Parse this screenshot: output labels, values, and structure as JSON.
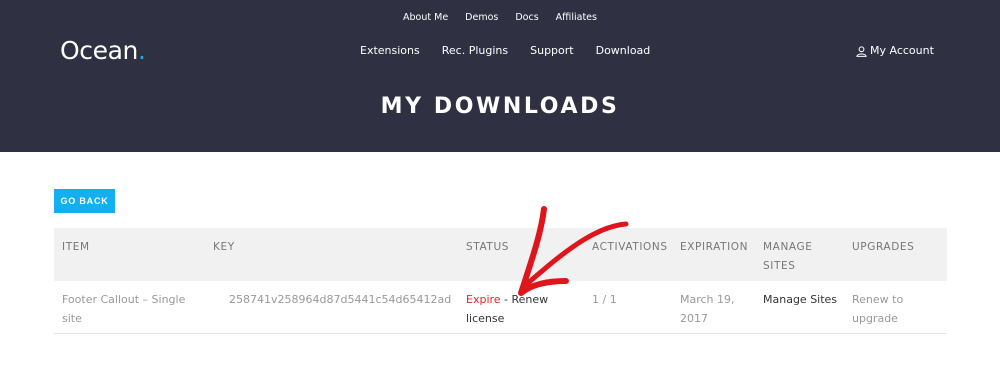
{
  "top_nav": [
    "About Me",
    "Demos",
    "Docs",
    "Affiliates"
  ],
  "logo": {
    "text": "Ocean",
    "dot": "."
  },
  "main_nav": [
    "Extensions",
    "Rec. Plugins",
    "Support",
    "Download"
  ],
  "account": {
    "label": "My Account",
    "icon": "user-icon"
  },
  "page_title": "MY DOWNLOADS",
  "go_back_label": "GO BACK",
  "table": {
    "headers": {
      "item": "ITEM",
      "key": "KEY",
      "status": "STATUS",
      "activations": "ACTIVATIONS",
      "expiration": "EXPIRATION",
      "manage_line1": "MANAGE",
      "manage_line2": "SITES",
      "upgrades": "UPGRADES"
    },
    "row": {
      "item_line1": "Footer Callout – Single",
      "item_line2": "site",
      "key": "258741v258964d87d5441c54d65412ad",
      "status_expire": "Expire",
      "status_sep": " - ",
      "status_renew_line1": "Renew",
      "status_renew_line2": "license",
      "activations": "1 / 1",
      "expiration_line1": "March 19,",
      "expiration_line2": "2017",
      "manage": "Manage Sites",
      "upgrade_line1": "Renew to",
      "upgrade_line2": "upgrade"
    }
  },
  "colors": {
    "header_bg": "#2f3142",
    "accent": "#13aff0",
    "expire": "#e52525",
    "arrow": "#e0151c"
  }
}
